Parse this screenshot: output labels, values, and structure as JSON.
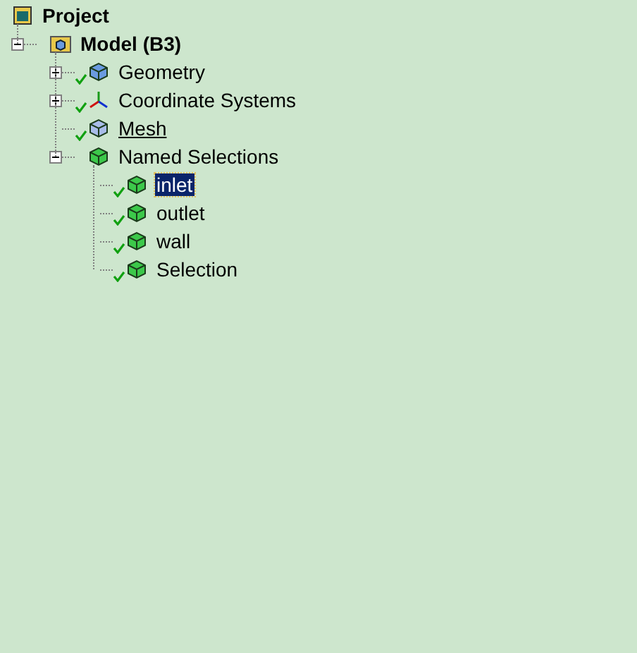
{
  "tree": [
    {
      "label": "Project",
      "kind": "project",
      "children": [
        {
          "label": "Model (B3)",
          "kind": "model",
          "expanded": true,
          "checked": false,
          "children": [
            {
              "label": "Geometry",
              "kind": "geometry",
              "expanded": false,
              "checked": true
            },
            {
              "label": "Coordinate Systems",
              "kind": "axes",
              "expanded": false,
              "checked": true
            },
            {
              "label": "Mesh",
              "kind": "mesh",
              "checked": true,
              "underlined": true
            },
            {
              "label": "Named Selections",
              "kind": "named",
              "expanded": true,
              "checked": false,
              "children": [
                {
                  "label": "inlet",
                  "kind": "selection",
                  "checked": true,
                  "selected": true
                },
                {
                  "label": "outlet",
                  "kind": "selection",
                  "checked": true,
                  "selected": false
                },
                {
                  "label": "wall",
                  "kind": "selection",
                  "checked": true,
                  "selected": false
                },
                {
                  "label": "Selection",
                  "kind": "selection",
                  "checked": true,
                  "selected": false
                }
              ]
            }
          ]
        }
      ]
    }
  ]
}
